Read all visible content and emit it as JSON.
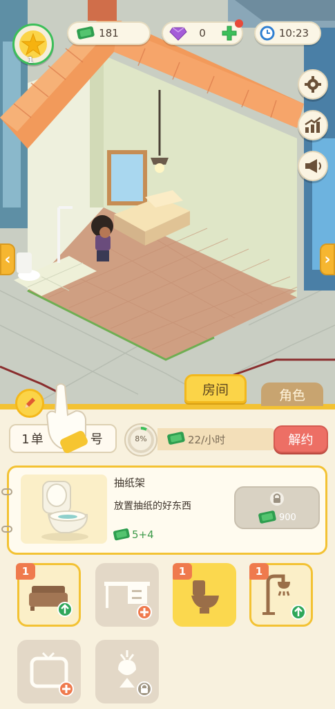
{
  "hud": {
    "level": "1",
    "cash": "181",
    "gems": "0",
    "clock": "10:23"
  },
  "tabs": {
    "room": "房间",
    "role": "角色"
  },
  "room": {
    "plate_left": "1单",
    "plate_right": "号",
    "progress": "8%",
    "income": "22/小时",
    "cancel_label": "解约"
  },
  "item": {
    "name": "抽纸架",
    "desc": "放置抽纸的好东西",
    "stat": "5+4",
    "price": "900"
  },
  "slots": [
    {
      "name": "bed",
      "badge": "1"
    },
    {
      "name": "desk",
      "badge": ""
    },
    {
      "name": "toilet",
      "badge": "1"
    },
    {
      "name": "shower",
      "badge": "1"
    },
    {
      "name": "tv",
      "badge": ""
    },
    {
      "name": "lamp",
      "badge": ""
    }
  ],
  "colors": {
    "accent": "#f3c233",
    "cash": "#2e9e4f",
    "cancel": "#ed6f65"
  }
}
